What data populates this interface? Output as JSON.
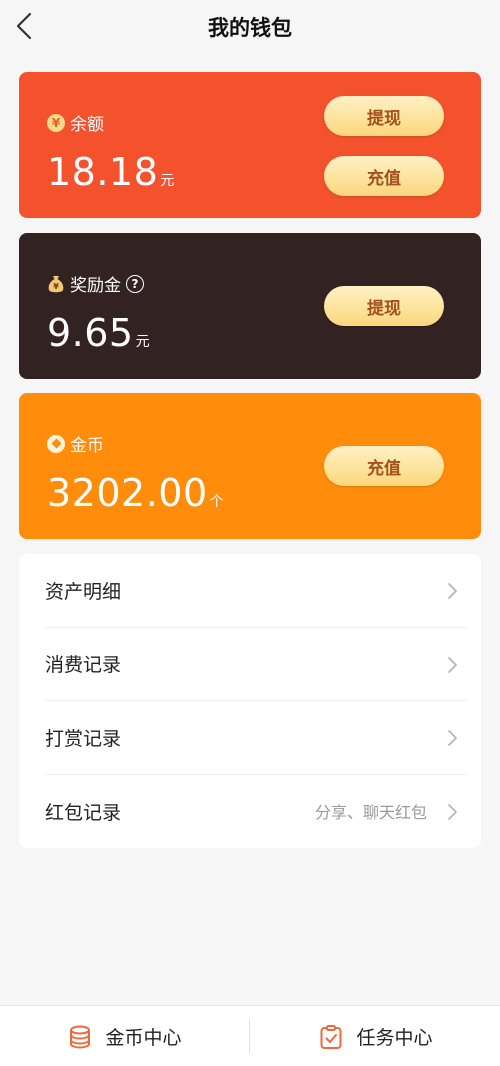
{
  "header": {
    "title": "我的钱包"
  },
  "balance": {
    "label": "余额",
    "icon": "yen-icon",
    "amount": "18.18",
    "unit": "元",
    "withdraw_label": "提现",
    "recharge_label": "充值",
    "bg_color": "#f4522d"
  },
  "reward": {
    "label": "奖励金",
    "icon": "money-bag-icon",
    "amount": "9.65",
    "unit": "元",
    "withdraw_label": "提现",
    "bg_color": "#332222"
  },
  "coin": {
    "label": "金币",
    "icon": "coin-icon",
    "amount": "3202.00",
    "unit": "个",
    "recharge_label": "充值",
    "bg_color": "#ff8c0a"
  },
  "menu": {
    "items": [
      {
        "label": "资产明细",
        "note": ""
      },
      {
        "label": "消费记录",
        "note": ""
      },
      {
        "label": "打赏记录",
        "note": ""
      },
      {
        "label": "红包记录",
        "note": "分享、聊天红包"
      }
    ]
  },
  "tabbar": {
    "left": {
      "label": "金币中心",
      "icon": "coin-stack-icon"
    },
    "right": {
      "label": "任务中心",
      "icon": "clipboard-check-icon"
    },
    "accent_color": "#ee6a3a"
  }
}
